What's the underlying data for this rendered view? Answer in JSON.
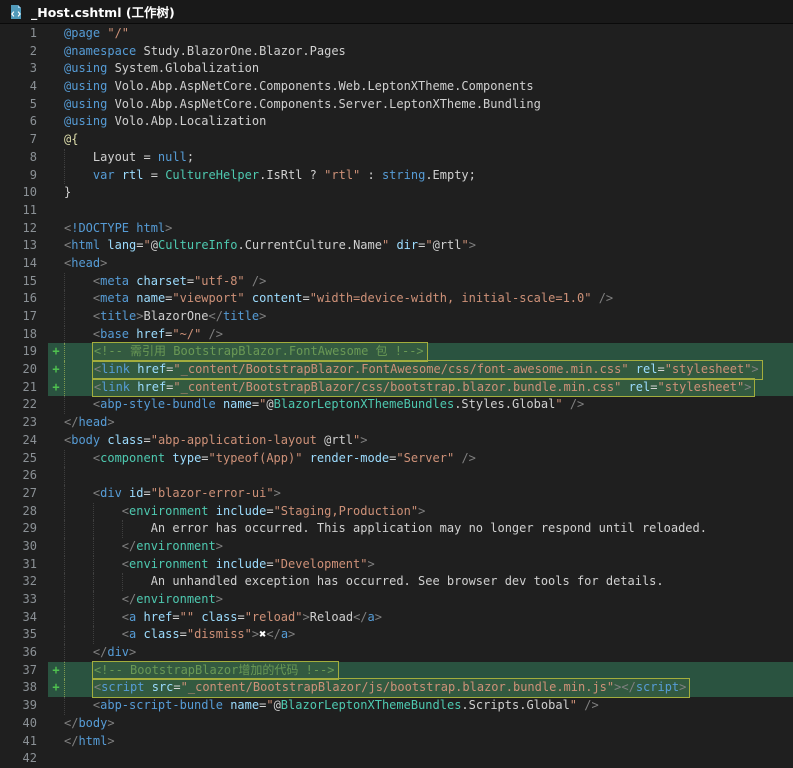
{
  "window": {
    "title": "_Host.cshtml (工作树)",
    "icon": "file-code-icon"
  },
  "editor": {
    "colors": {
      "background": "#1f1f1f",
      "titlebar_bg": "#191919",
      "title_text": "#ffffff",
      "line_number": "#8b9196",
      "added_line_bg": "#2a5340",
      "diff_plus": "#4fc24f",
      "diff_box_border": "#a3ad3d",
      "diff_box_bg": "#a3ad3d14",
      "indent_guide": "#3f3f3f",
      "indent_guide_added": "#7d9950"
    },
    "token_colors": {
      "pl": "#d0d0d0",
      "kw": "#569cd6",
      "at": "#9cdcfe",
      "st": "#ce9178",
      "ty": "#4ec9b0",
      "cm": "#6a9955",
      "pn": "#808080",
      "op": "#d4d4d4",
      "fn": "#dcdcaa",
      "xg": "#ffffff"
    },
    "lines": [
      {
        "n": 1,
        "ind": 0,
        "seg": [
          [
            "kw",
            "@page"
          ],
          [
            "pl",
            " "
          ],
          [
            "st",
            "\"/\""
          ]
        ]
      },
      {
        "n": 2,
        "ind": 0,
        "seg": [
          [
            "kw",
            "@namespace"
          ],
          [
            "pl",
            " Study.BlazorOne.Blazor.Pages"
          ]
        ]
      },
      {
        "n": 3,
        "ind": 0,
        "seg": [
          [
            "kw",
            "@using"
          ],
          [
            "pl",
            " System.Globalization"
          ]
        ]
      },
      {
        "n": 4,
        "ind": 0,
        "seg": [
          [
            "kw",
            "@using"
          ],
          [
            "pl",
            " Volo.Abp.AspNetCore.Components.Web.LeptonXTheme.Components"
          ]
        ]
      },
      {
        "n": 5,
        "ind": 0,
        "seg": [
          [
            "kw",
            "@using"
          ],
          [
            "pl",
            " Volo.Abp.AspNetCore.Components.Server.LeptonXTheme.Bundling"
          ]
        ]
      },
      {
        "n": 6,
        "ind": 0,
        "seg": [
          [
            "kw",
            "@using"
          ],
          [
            "pl",
            " Volo.Abp.Localization"
          ]
        ]
      },
      {
        "n": 7,
        "ind": 0,
        "seg": [
          [
            "fn",
            "@{"
          ]
        ]
      },
      {
        "n": 8,
        "ind": 4,
        "seg": [
          [
            "pl",
            "Layout = "
          ],
          [
            "kw",
            "null"
          ],
          [
            "pl",
            ";"
          ]
        ]
      },
      {
        "n": 9,
        "ind": 4,
        "seg": [
          [
            "kw",
            "var"
          ],
          [
            "pl",
            " "
          ],
          [
            "at",
            "rtl"
          ],
          [
            "pl",
            " = "
          ],
          [
            "ty",
            "CultureHelper"
          ],
          [
            "pl",
            ".IsRtl ? "
          ],
          [
            "st",
            "\"rtl\""
          ],
          [
            "pl",
            " : "
          ],
          [
            "kw",
            "string"
          ],
          [
            "pl",
            ".Empty;"
          ]
        ]
      },
      {
        "n": 10,
        "ind": 0,
        "seg": [
          [
            "pl",
            "}"
          ]
        ]
      },
      {
        "n": 11,
        "ind": 0,
        "seg": []
      },
      {
        "n": 12,
        "ind": 0,
        "seg": [
          [
            "pn",
            "<"
          ],
          [
            "kw",
            "!DOCTYPE html"
          ],
          [
            "pn",
            ">"
          ]
        ]
      },
      {
        "n": 13,
        "ind": 0,
        "seg": [
          [
            "pn",
            "<"
          ],
          [
            "kw",
            "html"
          ],
          [
            "pl",
            " "
          ],
          [
            "at",
            "lang"
          ],
          [
            "op",
            "="
          ],
          [
            "st",
            "\""
          ],
          [
            "pl",
            "@"
          ],
          [
            "ty",
            "CultureInfo"
          ],
          [
            "pl",
            ".CurrentCulture.Name"
          ],
          [
            "st",
            "\""
          ],
          [
            "pl",
            " "
          ],
          [
            "at",
            "dir"
          ],
          [
            "op",
            "="
          ],
          [
            "st",
            "\""
          ],
          [
            "pl",
            "@rtl"
          ],
          [
            "st",
            "\""
          ],
          [
            "pn",
            ">"
          ]
        ]
      },
      {
        "n": 14,
        "ind": 0,
        "seg": [
          [
            "pn",
            "<"
          ],
          [
            "kw",
            "head"
          ],
          [
            "pn",
            ">"
          ]
        ]
      },
      {
        "n": 15,
        "ind": 4,
        "seg": [
          [
            "pn",
            "<"
          ],
          [
            "kw",
            "meta"
          ],
          [
            "pl",
            " "
          ],
          [
            "at",
            "charset"
          ],
          [
            "op",
            "="
          ],
          [
            "st",
            "\"utf-8\""
          ],
          [
            "pl",
            " "
          ],
          [
            "pn",
            "/>"
          ]
        ]
      },
      {
        "n": 16,
        "ind": 4,
        "seg": [
          [
            "pn",
            "<"
          ],
          [
            "kw",
            "meta"
          ],
          [
            "pl",
            " "
          ],
          [
            "at",
            "name"
          ],
          [
            "op",
            "="
          ],
          [
            "st",
            "\"viewport\""
          ],
          [
            "pl",
            " "
          ],
          [
            "at",
            "content"
          ],
          [
            "op",
            "="
          ],
          [
            "st",
            "\"width=device-width, initial-scale=1.0\""
          ],
          [
            "pl",
            " "
          ],
          [
            "pn",
            "/>"
          ]
        ]
      },
      {
        "n": 17,
        "ind": 4,
        "seg": [
          [
            "pn",
            "<"
          ],
          [
            "kw",
            "title"
          ],
          [
            "pn",
            ">"
          ],
          [
            "pl",
            "BlazorOne"
          ],
          [
            "pn",
            "</"
          ],
          [
            "kw",
            "title"
          ],
          [
            "pn",
            ">"
          ]
        ]
      },
      {
        "n": 18,
        "ind": 4,
        "seg": [
          [
            "pn",
            "<"
          ],
          [
            "kw",
            "base"
          ],
          [
            "pl",
            " "
          ],
          [
            "at",
            "href"
          ],
          [
            "op",
            "="
          ],
          [
            "st",
            "\"~/\""
          ],
          [
            "pl",
            " "
          ],
          [
            "pn",
            "/>"
          ]
        ]
      },
      {
        "n": 19,
        "ind": 4,
        "added": true,
        "boxed": true,
        "seg": [
          [
            "cm",
            "<!-- 需引用 BootstrapBlazor.FontAwesome 包 !-->"
          ]
        ]
      },
      {
        "n": 20,
        "ind": 4,
        "added": true,
        "boxed": true,
        "seg": [
          [
            "pn",
            "<"
          ],
          [
            "kw",
            "link"
          ],
          [
            "pl",
            " "
          ],
          [
            "at",
            "href"
          ],
          [
            "op",
            "="
          ],
          [
            "st",
            "\"_content/BootstrapBlazor.FontAwesome/css/font-awesome.min.css\""
          ],
          [
            "pl",
            " "
          ],
          [
            "at",
            "rel"
          ],
          [
            "op",
            "="
          ],
          [
            "st",
            "\"stylesheet\""
          ],
          [
            "pn",
            ">"
          ]
        ]
      },
      {
        "n": 21,
        "ind": 4,
        "added": true,
        "boxed": true,
        "seg": [
          [
            "pn",
            "<"
          ],
          [
            "kw",
            "link"
          ],
          [
            "pl",
            " "
          ],
          [
            "at",
            "href"
          ],
          [
            "op",
            "="
          ],
          [
            "st",
            "\"_content/BootstrapBlazor/css/bootstrap.blazor.bundle.min.css\""
          ],
          [
            "pl",
            " "
          ],
          [
            "at",
            "rel"
          ],
          [
            "op",
            "="
          ],
          [
            "st",
            "\"stylesheet\""
          ],
          [
            "pn",
            ">"
          ]
        ]
      },
      {
        "n": 22,
        "ind": 4,
        "seg": [
          [
            "pn",
            "<"
          ],
          [
            "kw",
            "abp-style-bundle"
          ],
          [
            "pl",
            " "
          ],
          [
            "at",
            "name"
          ],
          [
            "op",
            "="
          ],
          [
            "st",
            "\""
          ],
          [
            "pl",
            "@"
          ],
          [
            "ty",
            "BlazorLeptonXThemeBundles"
          ],
          [
            "pl",
            ".Styles.Global"
          ],
          [
            "st",
            "\""
          ],
          [
            "pl",
            " "
          ],
          [
            "pn",
            "/>"
          ]
        ]
      },
      {
        "n": 23,
        "ind": 0,
        "seg": [
          [
            "pn",
            "</"
          ],
          [
            "kw",
            "head"
          ],
          [
            "pn",
            ">"
          ]
        ]
      },
      {
        "n": 24,
        "ind": 0,
        "seg": [
          [
            "pn",
            "<"
          ],
          [
            "kw",
            "body"
          ],
          [
            "pl",
            " "
          ],
          [
            "at",
            "class"
          ],
          [
            "op",
            "="
          ],
          [
            "st",
            "\"abp-application-layout "
          ],
          [
            "pl",
            "@rtl"
          ],
          [
            "st",
            "\""
          ],
          [
            "pn",
            ">"
          ]
        ]
      },
      {
        "n": 25,
        "ind": 4,
        "seg": [
          [
            "pn",
            "<"
          ],
          [
            "ty",
            "component"
          ],
          [
            "pl",
            " "
          ],
          [
            "at",
            "type"
          ],
          [
            "op",
            "="
          ],
          [
            "st",
            "\"typeof(App)\""
          ],
          [
            "pl",
            " "
          ],
          [
            "at",
            "render-mode"
          ],
          [
            "op",
            "="
          ],
          [
            "st",
            "\"Server\""
          ],
          [
            "pl",
            " "
          ],
          [
            "pn",
            "/>"
          ]
        ]
      },
      {
        "n": 26,
        "ind": 4,
        "seg": []
      },
      {
        "n": 27,
        "ind": 4,
        "seg": [
          [
            "pn",
            "<"
          ],
          [
            "kw",
            "div"
          ],
          [
            "pl",
            " "
          ],
          [
            "at",
            "id"
          ],
          [
            "op",
            "="
          ],
          [
            "st",
            "\"blazor-error-ui\""
          ],
          [
            "pn",
            ">"
          ]
        ]
      },
      {
        "n": 28,
        "ind": 8,
        "seg": [
          [
            "pn",
            "<"
          ],
          [
            "ty",
            "environment"
          ],
          [
            "pl",
            " "
          ],
          [
            "at",
            "include"
          ],
          [
            "op",
            "="
          ],
          [
            "st",
            "\"Staging,Production\""
          ],
          [
            "pn",
            ">"
          ]
        ]
      },
      {
        "n": 29,
        "ind": 12,
        "seg": [
          [
            "pl",
            "An error has occurred. This application may no longer respond until reloaded."
          ]
        ]
      },
      {
        "n": 30,
        "ind": 8,
        "seg": [
          [
            "pn",
            "</"
          ],
          [
            "ty",
            "environment"
          ],
          [
            "pn",
            ">"
          ]
        ]
      },
      {
        "n": 31,
        "ind": 8,
        "seg": [
          [
            "pn",
            "<"
          ],
          [
            "ty",
            "environment"
          ],
          [
            "pl",
            " "
          ],
          [
            "at",
            "include"
          ],
          [
            "op",
            "="
          ],
          [
            "st",
            "\"Development\""
          ],
          [
            "pn",
            ">"
          ]
        ]
      },
      {
        "n": 32,
        "ind": 12,
        "seg": [
          [
            "pl",
            "An unhandled exception has occurred. See browser dev tools for details."
          ]
        ]
      },
      {
        "n": 33,
        "ind": 8,
        "seg": [
          [
            "pn",
            "</"
          ],
          [
            "ty",
            "environment"
          ],
          [
            "pn",
            ">"
          ]
        ]
      },
      {
        "n": 34,
        "ind": 8,
        "seg": [
          [
            "pn",
            "<"
          ],
          [
            "kw",
            "a"
          ],
          [
            "pl",
            " "
          ],
          [
            "at",
            "href"
          ],
          [
            "op",
            "="
          ],
          [
            "st",
            "\"\""
          ],
          [
            "pl",
            " "
          ],
          [
            "at",
            "class"
          ],
          [
            "op",
            "="
          ],
          [
            "st",
            "\"reload\""
          ],
          [
            "pn",
            ">"
          ],
          [
            "pl",
            "Reload"
          ],
          [
            "pn",
            "</"
          ],
          [
            "kw",
            "a"
          ],
          [
            "pn",
            ">"
          ]
        ]
      },
      {
        "n": 35,
        "ind": 8,
        "seg": [
          [
            "pn",
            "<"
          ],
          [
            "kw",
            "a"
          ],
          [
            "pl",
            " "
          ],
          [
            "at",
            "class"
          ],
          [
            "op",
            "="
          ],
          [
            "st",
            "\"dismiss\""
          ],
          [
            "pn",
            ">"
          ],
          [
            "xg",
            "✖"
          ],
          [
            "pn",
            "</"
          ],
          [
            "kw",
            "a"
          ],
          [
            "pn",
            ">"
          ]
        ]
      },
      {
        "n": 36,
        "ind": 4,
        "seg": [
          [
            "pn",
            "</"
          ],
          [
            "kw",
            "div"
          ],
          [
            "pn",
            ">"
          ]
        ]
      },
      {
        "n": 37,
        "ind": 4,
        "added": true,
        "boxed": true,
        "seg": [
          [
            "cm",
            "<!-- BootstrapBlazor增加的代码 !-->"
          ]
        ]
      },
      {
        "n": 38,
        "ind": 4,
        "added": true,
        "boxed": true,
        "seg": [
          [
            "pn",
            "<"
          ],
          [
            "kw",
            "script"
          ],
          [
            "pl",
            " "
          ],
          [
            "at",
            "src"
          ],
          [
            "op",
            "="
          ],
          [
            "st",
            "\"_content/BootstrapBlazor/js/bootstrap.blazor.bundle.min.js\""
          ],
          [
            "pn",
            "></"
          ],
          [
            "kw",
            "script"
          ],
          [
            "pn",
            ">"
          ]
        ]
      },
      {
        "n": 39,
        "ind": 4,
        "seg": [
          [
            "pn",
            "<"
          ],
          [
            "kw",
            "abp-script-bundle"
          ],
          [
            "pl",
            " "
          ],
          [
            "at",
            "name"
          ],
          [
            "op",
            "="
          ],
          [
            "st",
            "\""
          ],
          [
            "pl",
            "@"
          ],
          [
            "ty",
            "BlazorLeptonXThemeBundles"
          ],
          [
            "pl",
            ".Scripts.Global"
          ],
          [
            "st",
            "\""
          ],
          [
            "pl",
            " "
          ],
          [
            "pn",
            "/>"
          ]
        ]
      },
      {
        "n": 40,
        "ind": 0,
        "seg": [
          [
            "pn",
            "</"
          ],
          [
            "kw",
            "body"
          ],
          [
            "pn",
            ">"
          ]
        ]
      },
      {
        "n": 41,
        "ind": 0,
        "seg": [
          [
            "pn",
            "</"
          ],
          [
            "kw",
            "html"
          ],
          [
            "pn",
            ">"
          ]
        ]
      },
      {
        "n": 42,
        "ind": 0,
        "seg": []
      }
    ]
  }
}
